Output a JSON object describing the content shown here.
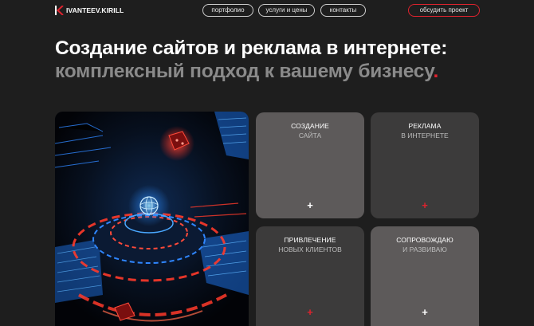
{
  "header": {
    "logo_text": "IVANTEEV.KIRILL",
    "nav": [
      "портфолио",
      "услуги и цены",
      "контакты"
    ],
    "cta_label": "обсудить проект"
  },
  "hero": {
    "title_line1": "Создание сайтов и реклама в интернете:",
    "title_line2": "комплексный подход к вашему бизнесу",
    "title_dot": "."
  },
  "services": [
    {
      "title": "СОЗДАНИЕ",
      "subtitle": "САЙТА",
      "icon": "plus-icon"
    },
    {
      "title": "РЕКЛАМА",
      "subtitle": "В ИНТЕРНЕТЕ",
      "icon": "plus-icon"
    },
    {
      "title": "ПРИВЛЕЧЕНИЕ",
      "subtitle": "НОВЫХ КЛИЕНТОВ",
      "icon": "plus-icon"
    },
    {
      "title": "СОПРОВОЖДАЮ",
      "subtitle": "И РАЗВИВАЮ",
      "icon": "plus-icon"
    }
  ],
  "colors": {
    "background": "#1e1e1e",
    "accent": "#e0222e",
    "card_light": "#5d5a5a",
    "card_dark": "#3c3b3b"
  }
}
